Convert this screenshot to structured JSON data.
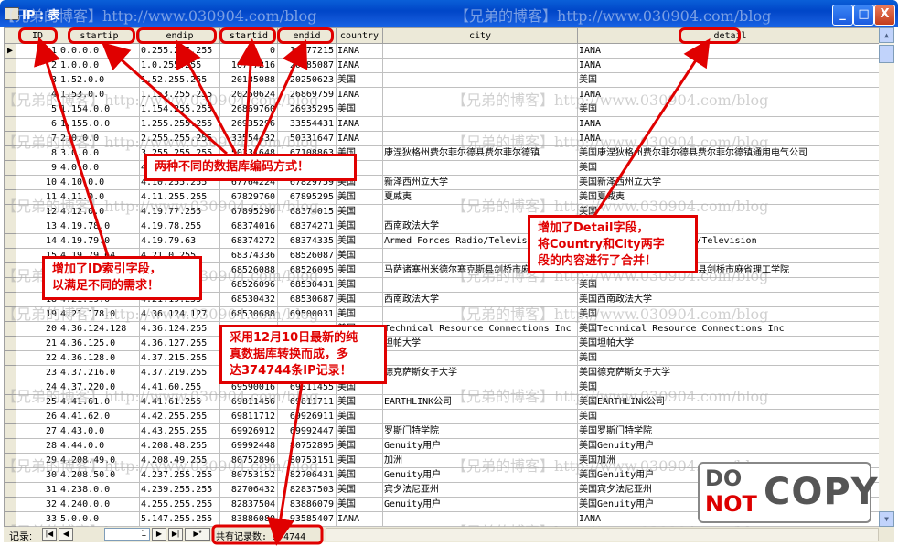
{
  "window": {
    "title": "IP : 表",
    "minimize_glyph": "_",
    "maximize_glyph": "□",
    "close_glyph": "X"
  },
  "watermark": "【兄弟的博客】http://www.030904.com/blog",
  "grid": {
    "columns": [
      "ID",
      "startip",
      "endip",
      "startid",
      "endid",
      "country",
      "city",
      "detail"
    ],
    "current_row_glyph": "▶",
    "rows": [
      [
        "1",
        "0.0.0.0",
        "0.255.255.255",
        "0",
        "16777215",
        "IANA",
        "",
        "IANA"
      ],
      [
        "2",
        "1.0.0.0",
        "1.0.255.255",
        "16777216",
        "20185087",
        "IANA",
        "",
        "IANA"
      ],
      [
        "3",
        "1.52.0.0",
        "1.52.255.255",
        "20185088",
        "20250623",
        "美国",
        "",
        "美国"
      ],
      [
        "4",
        "1.53.0.0",
        "1.153.255.255",
        "20250624",
        "26869759",
        "IANA",
        "",
        "IANA"
      ],
      [
        "5",
        "1.154.0.0",
        "1.154.255.255",
        "26869760",
        "26935295",
        "美国",
        "",
        "美国"
      ],
      [
        "6",
        "1.155.0.0",
        "1.255.255.255",
        "26935296",
        "33554431",
        "IANA",
        "",
        "IANA"
      ],
      [
        "7",
        "2.0.0.0",
        "2.255.255.255",
        "33554432",
        "50331647",
        "IANA",
        "",
        "IANA"
      ],
      [
        "8",
        "3.0.0.0",
        "3.255.255.255",
        "50331648",
        "67108863",
        "美国",
        "康涅狄格州费尔菲尔德县费尔菲尔德镇",
        "美国康涅狄格州费尔菲尔德县费尔菲尔德镇通用电气公司"
      ],
      [
        "9",
        "4.0.0.0",
        "4.10.255.255",
        "67108864",
        "67829759",
        "美国",
        "",
        "美国"
      ],
      [
        "10",
        "4.10.0.0",
        "4.10.255.255",
        "67764224",
        "67829759",
        "美国",
        "新泽西州立大学",
        "美国新泽西州立大学"
      ],
      [
        "11",
        "4.11.0.0",
        "4.11.255.255",
        "67829760",
        "67895295",
        "美国",
        "夏威夷",
        "美国夏威夷"
      ],
      [
        "12",
        "4.12.0.0",
        "4.19.77.255",
        "67895296",
        "68374015",
        "美国",
        "",
        "美国"
      ],
      [
        "13",
        "4.19.78.0",
        "4.19.78.255",
        "68374016",
        "68374271",
        "美国",
        "西南政法大学",
        "美国西南政法大学"
      ],
      [
        "14",
        "4.19.79.0",
        "4.19.79.63",
        "68374272",
        "68374335",
        "美国",
        "Armed Forces Radio/Television",
        "美国Armed Forces Radio/Television"
      ],
      [
        "15",
        "4.19.79.64",
        "4.21.0.255",
        "68374336",
        "68526087",
        "美国",
        "",
        "美国"
      ],
      [
        "16",
        "4.21.1.0",
        "4.21.1.7",
        "68526088",
        "68526095",
        "美国",
        "马萨诸塞州米德尔塞克斯县剑桥市麻省理工学院",
        "美国马萨诸塞州米德尔塞克斯县剑桥市麻省理工学院"
      ],
      [
        "17",
        "4.21.1.8",
        "4.21.7.255",
        "68526096",
        "68530431",
        "美国",
        "",
        "美国"
      ],
      [
        "18",
        "4.21.19.0",
        "4.21.19.255",
        "68530432",
        "68530687",
        "美国",
        "西南政法大学",
        "美国西南政法大学"
      ],
      [
        "19",
        "4.21.178.0",
        "4.36.124.127",
        "68530688",
        "69500031",
        "美国",
        "",
        "美国"
      ],
      [
        "20",
        "4.36.124.128",
        "4.36.124.255",
        "69500032",
        "69500159",
        "美国",
        "Technical Resource Connections Inc",
        "美国Technical Resource Connections Inc"
      ],
      [
        "21",
        "4.36.125.0",
        "4.36.127.255",
        "69500160",
        "69500927",
        "美国",
        "坦帕大学",
        "美国坦帕大学"
      ],
      [
        "22",
        "4.36.128.0",
        "4.37.215.255",
        "69500928",
        "69588991",
        "美国",
        "",
        "美国"
      ],
      [
        "23",
        "4.37.216.0",
        "4.37.219.255",
        "69588992",
        "69590015",
        "美国",
        "德克萨斯女子大学",
        "美国德克萨斯女子大学"
      ],
      [
        "24",
        "4.37.220.0",
        "4.41.60.255",
        "69590016",
        "69811455",
        "美国",
        "",
        "美国"
      ],
      [
        "25",
        "4.41.61.0",
        "4.41.61.255",
        "69811456",
        "69811711",
        "美国",
        "EARTHLINK公司",
        "美国EARTHLINK公司"
      ],
      [
        "26",
        "4.41.62.0",
        "4.42.255.255",
        "69811712",
        "69926911",
        "美国",
        "",
        "美国"
      ],
      [
        "27",
        "4.43.0.0",
        "4.43.255.255",
        "69926912",
        "69992447",
        "美国",
        "罗斯门特学院",
        "美国罗斯门特学院"
      ],
      [
        "28",
        "4.44.0.0",
        "4.208.48.255",
        "69992448",
        "80752895",
        "美国",
        "Genuity用户",
        "美国Genuity用户"
      ],
      [
        "29",
        "4.208.49.0",
        "4.208.49.255",
        "80752896",
        "80753151",
        "美国",
        "加洲",
        "美国加洲"
      ],
      [
        "30",
        "4.208.50.0",
        "4.237.255.255",
        "80753152",
        "82706431",
        "美国",
        "Genuity用户",
        "美国Genuity用户"
      ],
      [
        "31",
        "4.238.0.0",
        "4.239.255.255",
        "82706432",
        "82837503",
        "美国",
        "宾夕法尼亚州",
        "美国宾夕法尼亚州"
      ],
      [
        "32",
        "4.240.0.0",
        "4.255.255.255",
        "82837504",
        "83886079",
        "美国",
        "Genuity用户",
        "美国Genuity用户"
      ],
      [
        "33",
        "5.0.0.0",
        "5.147.255.255",
        "83886080",
        "93585407",
        "IANA",
        "",
        "IANA"
      ]
    ]
  },
  "navigator": {
    "label": "记录:",
    "current_record": "1",
    "first_glyph": "|◀",
    "prev_glyph": "◀",
    "next_glyph": "▶",
    "last_glyph": "▶|",
    "new_glyph": "▶*",
    "total_text": "共有记录数: 374744"
  },
  "annotations": {
    "encoding": "两种不同的数据库编码方式！",
    "detail_line1": "增加了Detail字段，",
    "detail_line2": "将Country和City两字",
    "detail_line3": "段的内容进行了合并！",
    "id_line1": "增加了ID索引字段，",
    "id_line2": "以满足不同的需求！",
    "source_line1": "采用12月10日最新的纯",
    "source_line2": "真数据库转换而成，多",
    "source_line3": "达374744条IP记录！"
  },
  "logo": {
    "do": "DO",
    "not": "NOT",
    "copy": "COPY"
  },
  "colors": {
    "annotation_red": "#e00000",
    "titlebar_blue": "#0046c8",
    "face": "#ece9d8"
  }
}
